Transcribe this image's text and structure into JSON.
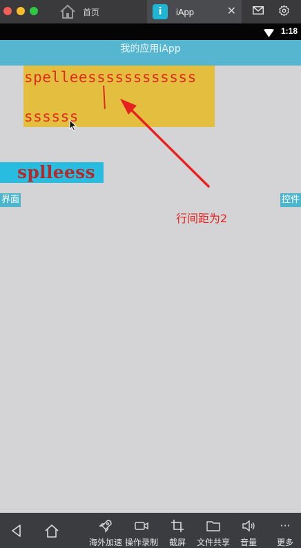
{
  "browser": {
    "home_tab_label": "首页",
    "app_tab_label": "iApp",
    "app_tab_icon_glyph": "i",
    "close_glyph": "✕"
  },
  "status_bar": {
    "time": "1:18"
  },
  "app_bar": {
    "title": "我的应用iApp"
  },
  "content": {
    "text_line_1": "spelleessssssssssss",
    "text_line_2": "ssssss",
    "cyan_text": "splleess",
    "left_button": "界面",
    "right_button": "控件",
    "annotation": "行间距为2"
  },
  "toolbar": {
    "items": [
      {
        "label": "海外加速",
        "icon": "rocket-icon"
      },
      {
        "label": "操作录制",
        "icon": "video-camera-icon"
      },
      {
        "label": "截屏",
        "icon": "crop-icon"
      },
      {
        "label": "文件共享",
        "icon": "folder-icon"
      },
      {
        "label": "音量",
        "icon": "speaker-icon"
      },
      {
        "label": "更多",
        "icon": "more-icon"
      }
    ],
    "more_glyph": "···"
  },
  "colors": {
    "accent_cyan": "#56b5cf",
    "yellow_box": "#e3be3f",
    "text_red": "#dd2a1d",
    "annotation_red": "#e7221e"
  }
}
